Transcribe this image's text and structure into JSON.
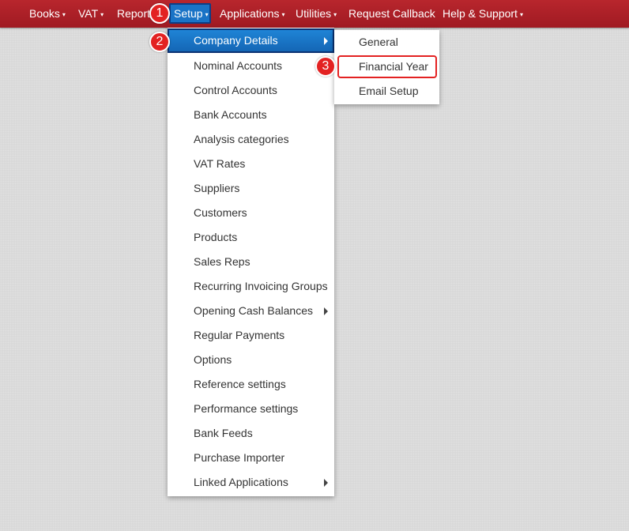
{
  "navbar": {
    "items": [
      {
        "label": "Books",
        "caret": "▾"
      },
      {
        "label": "VAT",
        "caret": "▾"
      },
      {
        "label": "Reports",
        "caret": ""
      },
      {
        "label": "Setup",
        "caret": "▾"
      },
      {
        "label": "Applications",
        "caret": "▾"
      },
      {
        "label": "Utilities",
        "caret": "▾"
      },
      {
        "label": "Request Callback",
        "caret": ""
      },
      {
        "label": "Help & Support",
        "caret": "▾"
      }
    ]
  },
  "setup_menu": {
    "items": [
      {
        "label": "Company Details",
        "has_submenu": true,
        "active": true
      },
      {
        "label": "Nominal Accounts"
      },
      {
        "label": "Control Accounts"
      },
      {
        "label": "Bank Accounts"
      },
      {
        "label": "Analysis categories"
      },
      {
        "label": "VAT Rates"
      },
      {
        "label": "Suppliers"
      },
      {
        "label": "Customers"
      },
      {
        "label": "Products"
      },
      {
        "label": "Sales Reps"
      },
      {
        "label": "Recurring Invoicing Groups"
      },
      {
        "label": "Opening Cash Balances",
        "has_submenu": true
      },
      {
        "label": "Regular Payments"
      },
      {
        "label": "Options"
      },
      {
        "label": "Reference settings"
      },
      {
        "label": "Performance settings"
      },
      {
        "label": "Bank Feeds"
      },
      {
        "label": "Purchase Importer"
      },
      {
        "label": "Linked Applications",
        "has_submenu": true
      }
    ]
  },
  "company_details_submenu": {
    "items": [
      {
        "label": "General"
      },
      {
        "label": "Financial Year"
      },
      {
        "label": "Email Setup"
      }
    ]
  },
  "annotations": {
    "badges": [
      "1",
      "2",
      "3"
    ]
  },
  "colors": {
    "navbar": "#a01a22",
    "active_item": "#1466b5",
    "badge": "#e32222"
  }
}
